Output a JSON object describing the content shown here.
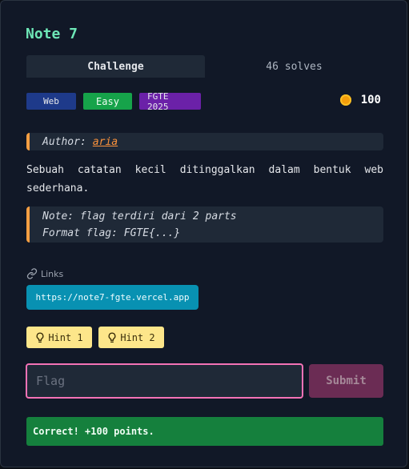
{
  "challenge": {
    "title": "Note 7",
    "tabs": [
      {
        "label": "Challenge",
        "active": true
      },
      {
        "label": "46 solves",
        "active": false
      }
    ],
    "tags": {
      "category": "Web",
      "difficulty": "Easy",
      "event": "FGTE 2025"
    },
    "points": "100",
    "author_label": "Author:",
    "author_name": "aria",
    "description": "Sebuah catatan kecil ditinggalkan dalam bentuk web sederhana.",
    "note_line_1": "Note: flag terdiri dari 2 parts",
    "note_line_2": "Format flag: FGTE{...}"
  },
  "links": {
    "label": "Links",
    "url": "https://note7-fgte.vercel.app"
  },
  "hints": [
    {
      "label": "Hint 1"
    },
    {
      "label": "Hint 2"
    }
  ],
  "submission": {
    "placeholder": "Flag",
    "value": "",
    "submit_label": "Submit",
    "status_message": "Correct! +100 points."
  },
  "colors": {
    "accent": "#6ee7b7",
    "callout_border": "#f59e42",
    "success": "#15803d",
    "input_focus": "#f472b6",
    "link_button": "#0891b2",
    "hint": "#fde68a"
  },
  "icons": {
    "coin": "coin-icon",
    "link": "link-icon",
    "hint": "lightbulb-icon"
  }
}
